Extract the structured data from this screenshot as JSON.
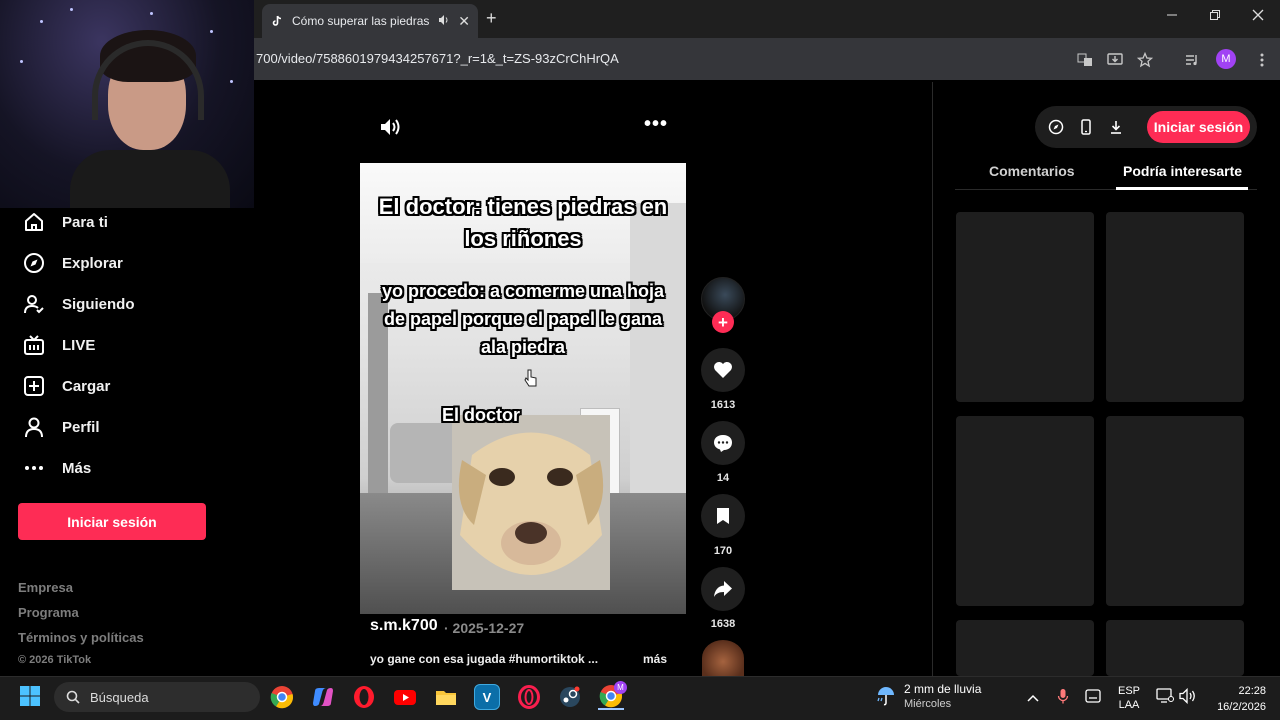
{
  "browser": {
    "tab_title": "Cómo superar las piedras e",
    "url": "700/video/7588601979434257671?_r=1&_t=ZS-93zCrChHrQA",
    "profile_initial": "M",
    "new_tab": "+",
    "tab_close": "✕"
  },
  "sidebar": {
    "items": [
      {
        "label": "Para ti",
        "icon": "home-icon"
      },
      {
        "label": "Explorar",
        "icon": "compass-icon"
      },
      {
        "label": "Siguiendo",
        "icon": "user-follow-icon"
      },
      {
        "label": "LIVE",
        "icon": "live-tv-icon"
      },
      {
        "label": "Cargar",
        "icon": "upload-plus-icon"
      },
      {
        "label": "Perfil",
        "icon": "profile-icon"
      },
      {
        "label": "Más",
        "icon": "more-dots-icon"
      }
    ],
    "login_label": "Iniciar sesión",
    "footer_links": [
      "Empresa",
      "Programa",
      "Términos y políticas"
    ],
    "copyright": "© 2026 TikTok"
  },
  "video": {
    "caption_top": "El doctor: tienes piedras en los riñones",
    "caption_mid": "yo procedo: a comerme una hoja de papel porque el papel le gana ala piedra",
    "caption_label": "El doctor",
    "more_dots": "•••"
  },
  "actions": {
    "likes": "1613",
    "comments": "14",
    "saves": "170",
    "shares": "1638",
    "follow_plus": "+"
  },
  "post": {
    "author": "s.m.k700",
    "date": "· 2025-12-27",
    "description": "yo gane con esa jugada #humortiktok ...",
    "more_label": "más"
  },
  "right_panel": {
    "login_label": "Iniciar sesión",
    "tabs": [
      {
        "label": "Comentarios",
        "active": false
      },
      {
        "label": "Podría interesarte",
        "active": true
      }
    ]
  },
  "taskbar": {
    "search_placeholder": "Búsqueda",
    "weather_title": "2 mm de lluvia",
    "weather_subtitle": "Miércoles",
    "lang_top": "ESP",
    "lang_bottom": "LAA",
    "time": "22:28",
    "date": "16/2/2026",
    "badge_letter": "M",
    "vb_letter": "V"
  },
  "colors": {
    "accent": "#fe2c55",
    "background": "#000000",
    "panel": "#1e1e1e"
  }
}
